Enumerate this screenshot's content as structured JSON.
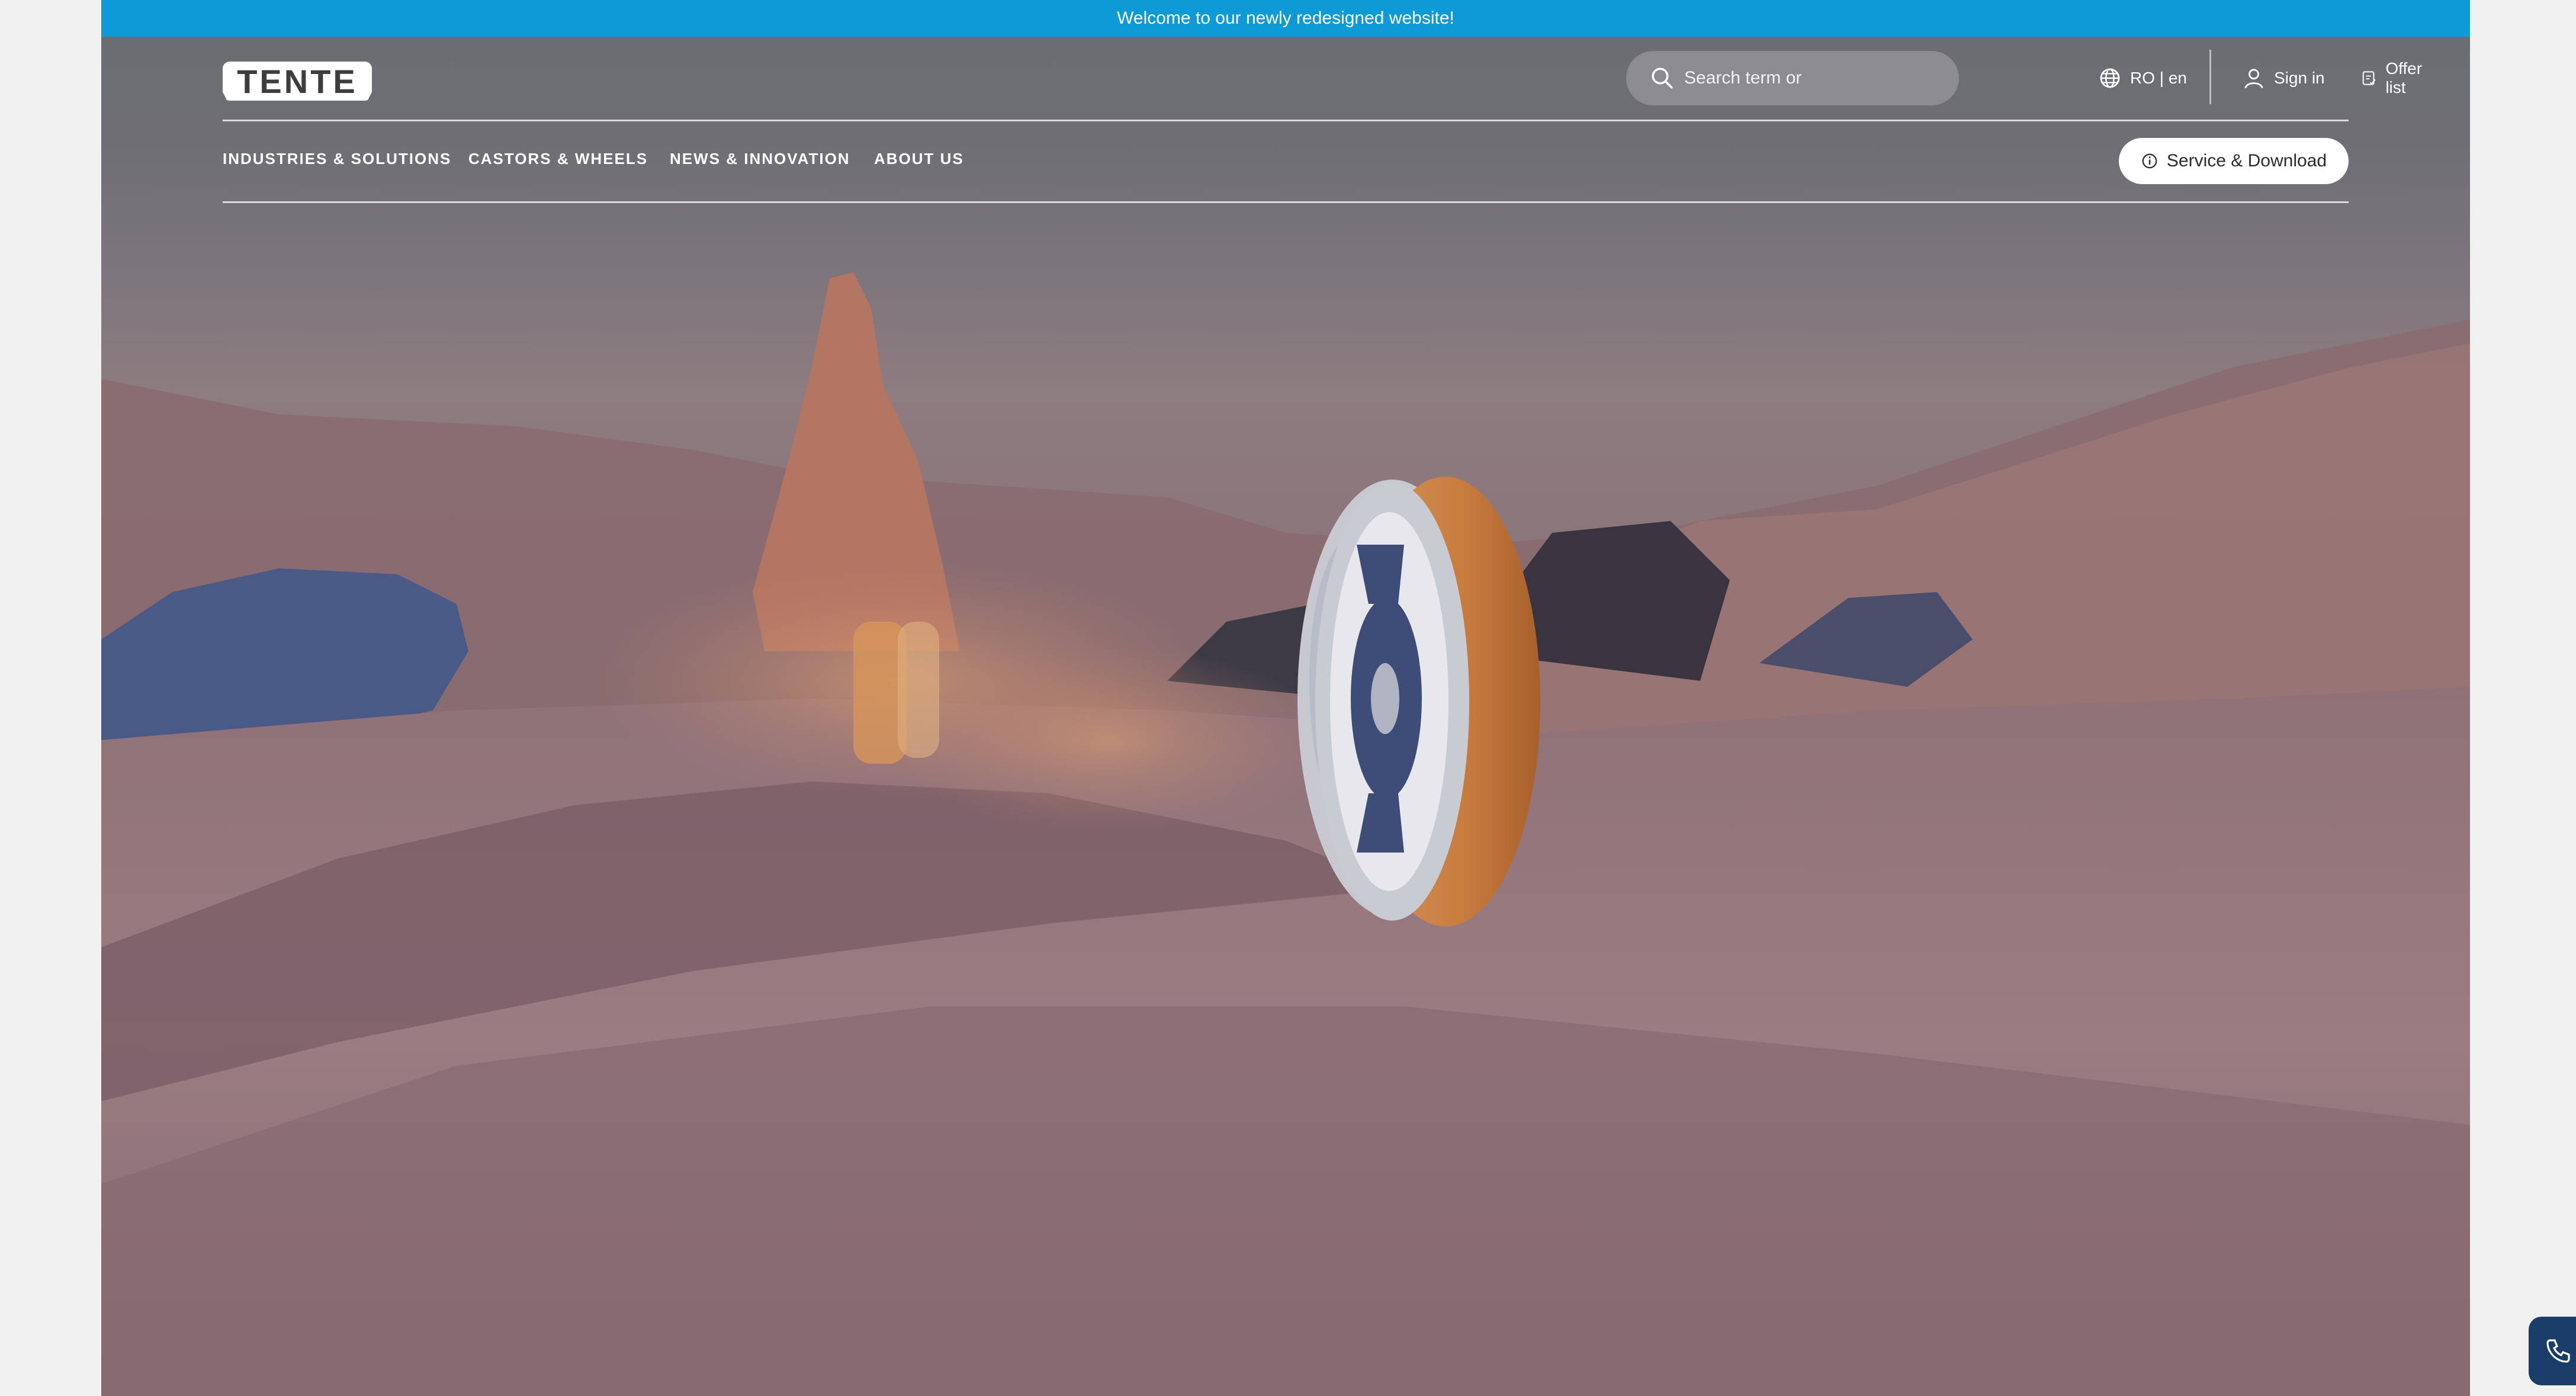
{
  "banner": {
    "text": "Welcome to our newly redesigned website!"
  },
  "header": {
    "logo_text": "TENTE",
    "search_placeholder": "Search term or",
    "language": "RO | en",
    "sign_in": "Sign in",
    "offer_list": "Offer list"
  },
  "nav": {
    "items": [
      {
        "label": "INDUSTRIES & SOLUTIONS"
      },
      {
        "label": "CASTORS & WHEELS"
      },
      {
        "label": "NEWS & INNOVATION"
      },
      {
        "label": "ABOUT US"
      }
    ],
    "service_button": "Service & Download"
  },
  "icons": {
    "search": "search-icon",
    "language": "globe-icon",
    "sign_in": "user-icon",
    "offer_list": "clipboard-icon",
    "service": "info-icon",
    "phone": "phone-icon"
  },
  "colors": {
    "banner": "#0d9ad7",
    "phone_fab": "#1a3c68",
    "wheel_tread": "#c87b3e"
  }
}
